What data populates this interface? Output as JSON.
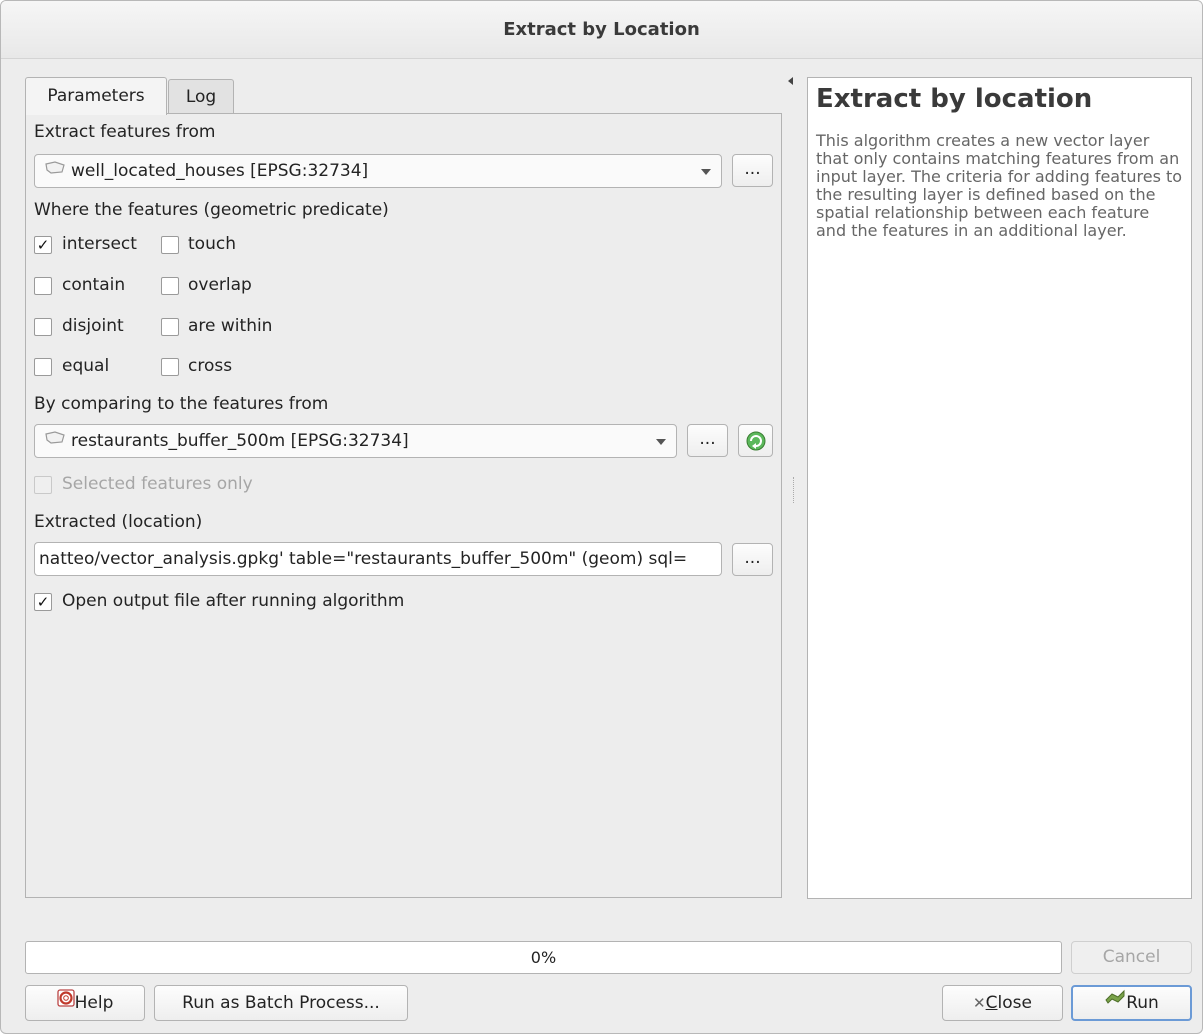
{
  "window": {
    "title": "Extract by Location"
  },
  "tabs": [
    {
      "label": "Parameters",
      "active": true
    },
    {
      "label": "Log",
      "active": false
    }
  ],
  "params": {
    "input_label": "Extract features from",
    "input_layer": "well_located_houses [EPSG:32734]",
    "predicate_label": "Where the features (geometric predicate)",
    "predicates": [
      {
        "label": "intersect",
        "checked": true
      },
      {
        "label": "touch",
        "checked": false
      },
      {
        "label": "contain",
        "checked": false
      },
      {
        "label": "overlap",
        "checked": false
      },
      {
        "label": "disjoint",
        "checked": false
      },
      {
        "label": "are within",
        "checked": false
      },
      {
        "label": "equal",
        "checked": false
      },
      {
        "label": "cross",
        "checked": false
      }
    ],
    "compare_label": "By comparing to the features from",
    "compare_layer": "restaurants_buffer_500m [EPSG:32734]",
    "selected_only_label": "Selected features only",
    "output_label": "Extracted (location)",
    "output_value": "natteo/vector_analysis.gpkg' table=\"restaurants_buffer_500m\" (geom) sql=",
    "open_output_label": "Open output file after running algorithm",
    "ellipsis": "..."
  },
  "help": {
    "title": "Extract by location",
    "text": "This algorithm creates a new vector layer that only contains matching features from an input layer. The criteria for adding features to the resulting layer is defined based on the spatial relationship between each feature and the features in an additional layer."
  },
  "progress": {
    "text": "0%",
    "value": 0
  },
  "buttons": {
    "cancel": "Cancel",
    "help": "Help",
    "batch": "Run as Batch Process...",
    "close_prefix": "",
    "close_mnemonic": "C",
    "close_rest": "lose",
    "run": "Run"
  },
  "check_mark": "✓"
}
